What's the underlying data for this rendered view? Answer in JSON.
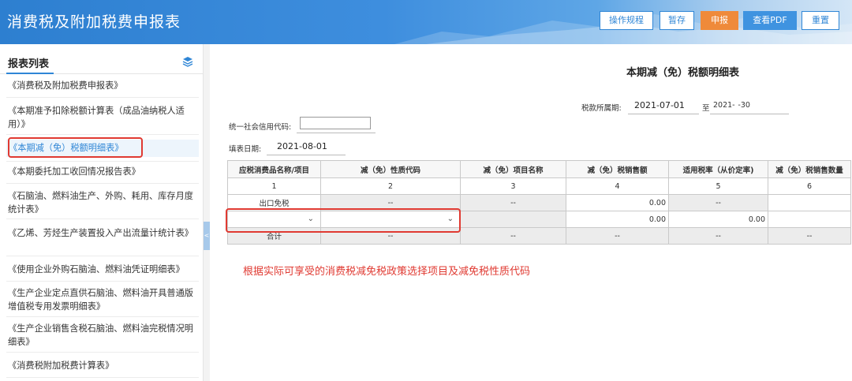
{
  "header": {
    "title": "消费税及附加税费申报表",
    "buttons": {
      "guide": "操作规程",
      "save_draft": "暂存",
      "submit": "申报",
      "view_pdf": "查看PDF",
      "reset": "重置"
    }
  },
  "sidebar": {
    "title": "报表列表",
    "items": [
      "《消费税及附加税费申报表》",
      "《本期准予扣除税额计算表（成品油纳税人适用）》",
      "《本期减（免）税额明细表》",
      "《本期委托加工收回情况报告表》",
      "《石脑油、燃料油生产、外购、耗用、库存月度统计表》",
      "《乙烯、芳烃生产装置投入产出流量计统计表》",
      "《使用企业外购石脑油、燃料油凭证明细表》",
      "《生产企业定点直供石脑油、燃料油开具普通版增值税专用发票明细表》",
      "《生产企业销售含税石脑油、燃料油完税情况明细表》",
      "《消费税附加税费计算表》"
    ],
    "active_index": 2
  },
  "form": {
    "title": "本期减（免）税额明细表",
    "period_label": "税款所属期:",
    "period_start": "2021-07-01",
    "period_to": "至",
    "period_end": "2021-  -30",
    "credit_code_label": "统一社会信用代码:",
    "fill_date_label": "填表日期:",
    "fill_date": "2021-08-01"
  },
  "table": {
    "headers": [
      "应税消费品名称/项目",
      "减（免）性质代码",
      "减（免）项目名称",
      "减（免）税销售额",
      "适用税率（从价定率)",
      "减（免）税销售数量"
    ],
    "numbers": [
      "1",
      "2",
      "3",
      "4",
      "5",
      "6"
    ],
    "row_export": [
      "出口免税",
      "--",
      "--",
      "0.00",
      "--",
      ""
    ],
    "row_select": [
      "",
      "",
      "",
      "0.00",
      "0.00",
      ""
    ],
    "row_total": [
      "合计",
      "--",
      "--",
      "--",
      "--",
      "--"
    ]
  },
  "note": "根据实际可享受的消费税减免税政策选择项目及减免税性质代码",
  "colors": {
    "brand": "#2f86d6",
    "accent": "#ef8a3a",
    "alert": "#e03a32"
  }
}
